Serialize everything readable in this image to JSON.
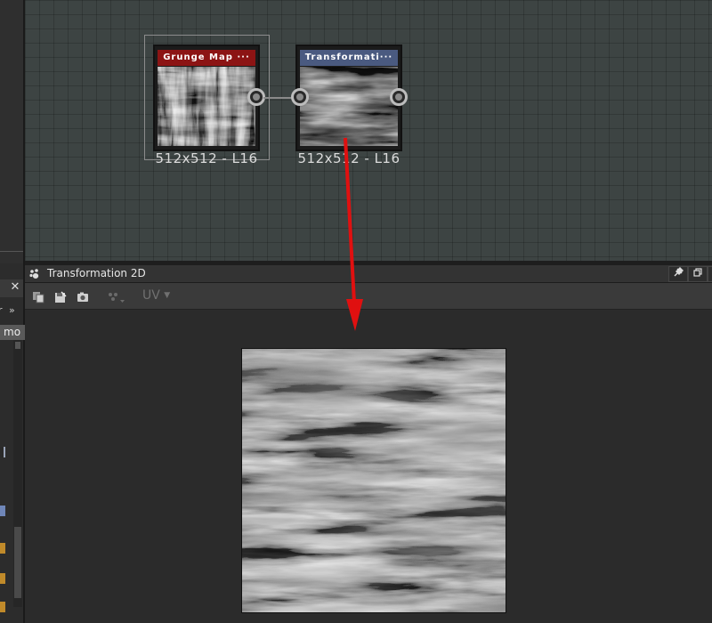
{
  "nodes": {
    "grunge": {
      "title": "Grunge Map ···",
      "caption": "512x512 - L16",
      "header_color": "#8c1414"
    },
    "transform": {
      "title": "Transformati···",
      "caption": "512x512 - L16",
      "header_color": "#4a5a80"
    }
  },
  "panel": {
    "title": "Transformation 2D",
    "close_label": "✕",
    "uv_label": "UV"
  },
  "left_panel": {
    "close_label": "✕",
    "expand_label": "»",
    "tab_label": "mo"
  },
  "icons": {
    "panel": "paw-icon",
    "pin": "pin-icon",
    "restore": "restore-window-icon",
    "copy": "copy-icon",
    "save": "save-icon",
    "camera": "camera-icon",
    "channels": "channels-icon"
  },
  "colors": {
    "arrow": "#e01010",
    "graph_bg": "#3d4443"
  }
}
